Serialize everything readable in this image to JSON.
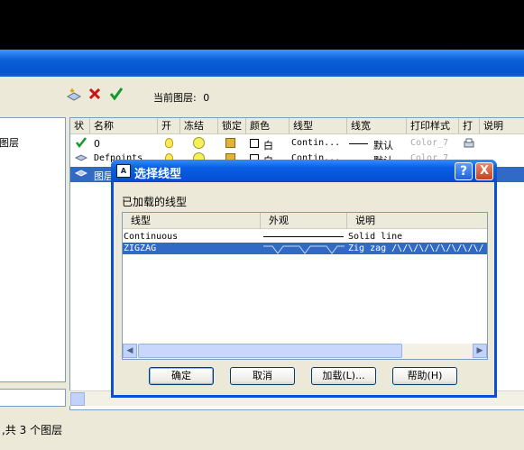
{
  "toolbar": {
    "current_layer_label": "当前图层:",
    "current_layer_value": "0"
  },
  "tree": {
    "item": "图层"
  },
  "layer_table": {
    "headers": [
      "状",
      "名称",
      "开",
      "冻结",
      "锁定",
      "颜色",
      "线型",
      "线宽",
      "打印样式",
      "打",
      "说明"
    ],
    "rows": [
      {
        "name": "0",
        "color": "白",
        "linetype": "Contin...",
        "lineweight": "默认",
        "plotstyle": "Color_7"
      },
      {
        "name": "Defpoints",
        "color": "白",
        "linetype": "Contin...",
        "lineweight": "默认",
        "plotstyle": "Color_7"
      },
      {
        "name": "图层1"
      }
    ]
  },
  "status": {
    "text": ",共 3 个图层"
  },
  "dialog": {
    "title": "选择线型",
    "help_btn": "?",
    "close_btn": "X",
    "loaded_label": "已加载的线型",
    "columns": [
      "线型",
      "外观",
      "说明"
    ],
    "linetypes": [
      {
        "name": "Continuous",
        "description": "Solid line"
      },
      {
        "name": "ZIGZAG",
        "description": "Zig zag /\\/\\/\\/\\/\\/\\/\\/\\/"
      }
    ],
    "buttons": {
      "ok": "确定",
      "cancel": "取消",
      "load": "加载(L)...",
      "help": "帮助(H)"
    }
  },
  "colors": {
    "titlebar": "#0a5ed8",
    "selection": "#316ac5",
    "face": "#ece9d8"
  }
}
